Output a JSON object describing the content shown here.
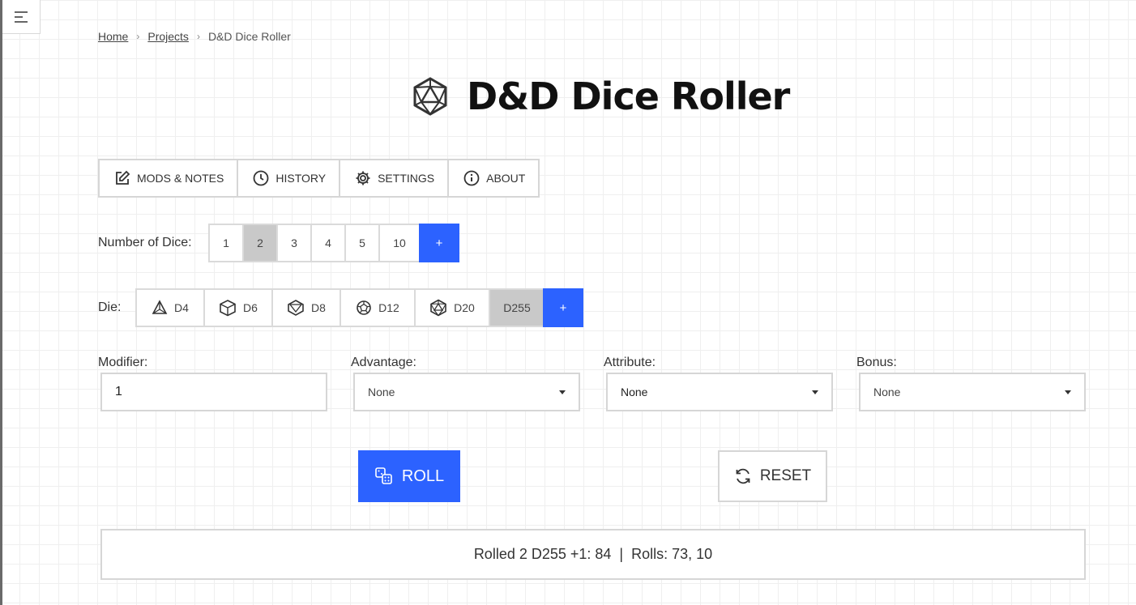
{
  "breadcrumb": {
    "home": "Home",
    "projects": "Projects",
    "current": "D&D Dice Roller",
    "separator": "›"
  },
  "title": "D&D Dice Roller",
  "tabs": [
    {
      "label": "MODS & NOTES",
      "icon": "edit-icon"
    },
    {
      "label": "HISTORY",
      "icon": "clock-icon"
    },
    {
      "label": "SETTINGS",
      "icon": "gear-icon"
    },
    {
      "label": "ABOUT",
      "icon": "info-icon"
    }
  ],
  "number_of_dice": {
    "label": "Number of Dice:",
    "options": [
      "1",
      "2",
      "3",
      "4",
      "5",
      "10"
    ],
    "selected": "2",
    "add_label": "+"
  },
  "die": {
    "label": "Die:",
    "options": [
      {
        "label": "D4",
        "icon": "d4-icon"
      },
      {
        "label": "D6",
        "icon": "d6-icon"
      },
      {
        "label": "D8",
        "icon": "d8-icon"
      },
      {
        "label": "D12",
        "icon": "d12-icon"
      },
      {
        "label": "D20",
        "icon": "d20-icon"
      },
      {
        "label": "D255",
        "icon": ""
      }
    ],
    "selected": "D255",
    "add_label": "+"
  },
  "fields": {
    "modifier": {
      "label": "Modifier:",
      "value": "1"
    },
    "advantage": {
      "label": "Advantage:",
      "value": "None"
    },
    "attribute": {
      "label": "Attribute:",
      "value": "None"
    },
    "bonus": {
      "label": "Bonus:",
      "value": "None"
    }
  },
  "actions": {
    "roll": "ROLL",
    "reset": "RESET"
  },
  "result": "Rolled 2 D255 +1: 84  |  Rolls: 73, 10",
  "colors": {
    "accent": "#2c62ff",
    "selected": "#c9c9c9",
    "border": "#d6d6d6"
  }
}
